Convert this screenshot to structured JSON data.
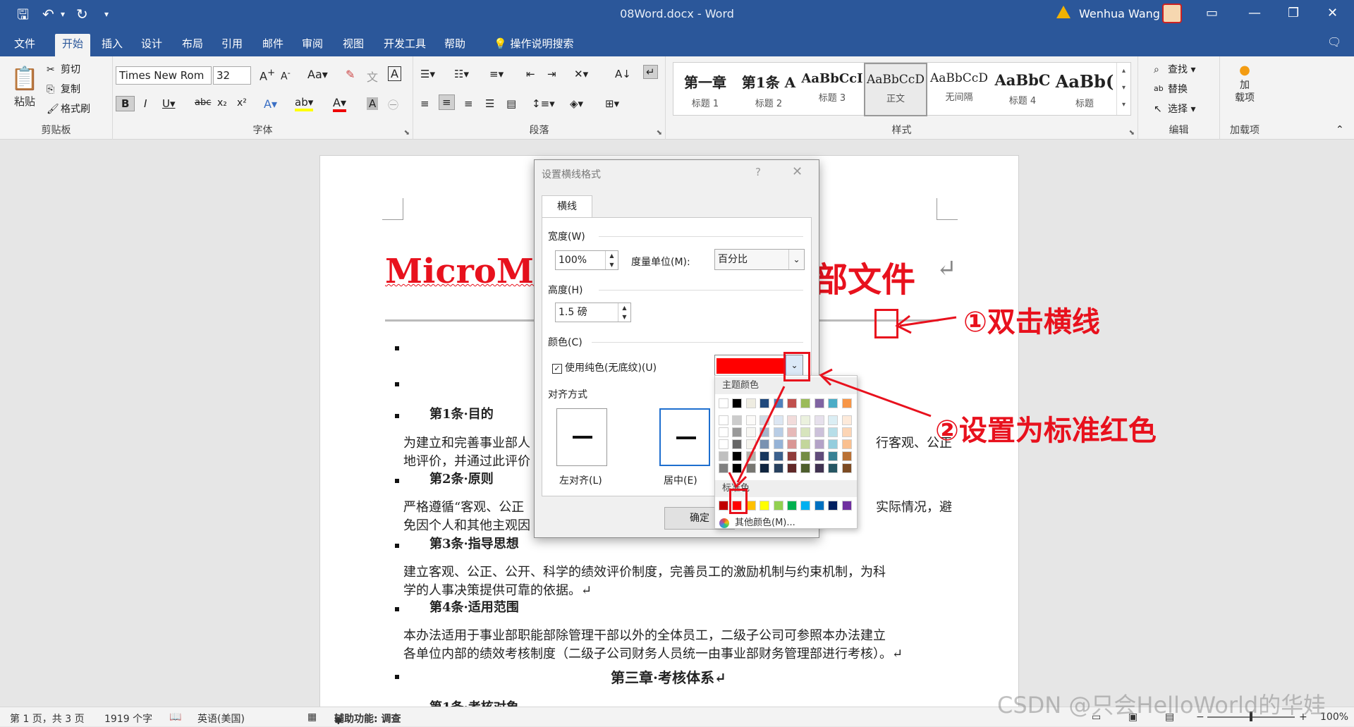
{
  "window": {
    "title": "08Word.docx  -  Word",
    "user": "Wenhua Wang"
  },
  "tabs": [
    "文件",
    "开始",
    "插入",
    "设计",
    "布局",
    "引用",
    "邮件",
    "审阅",
    "视图",
    "开发工具",
    "帮助"
  ],
  "tell_me": "操作说明搜索",
  "ribbon": {
    "clipboard": {
      "paste": "粘贴",
      "cut": "剪切",
      "copy": "复制",
      "format_painter": "格式刷",
      "label": "剪贴板"
    },
    "font": {
      "name": "Times New Rom",
      "size": "32",
      "label": "字体"
    },
    "paragraph": {
      "label": "段落"
    },
    "styles": {
      "label": "样式",
      "items": [
        {
          "sample": "第一章",
          "name": "标题 1"
        },
        {
          "sample": "第1条 A",
          "name": "标题 2"
        },
        {
          "sample": "AaBbCcI",
          "name": "标题 3"
        },
        {
          "sample": "AaBbCcD",
          "name": "正文"
        },
        {
          "sample": "AaBbCcD",
          "name": "无间隔"
        },
        {
          "sample": "AaBbC",
          "name": "标题 4"
        },
        {
          "sample": "AaBb(",
          "name": "标题"
        }
      ]
    },
    "editing": {
      "find": "查找",
      "replace": "替换",
      "select": "选择",
      "label": "编辑"
    },
    "addins": {
      "btn": "加\n载项",
      "label": "加载项"
    }
  },
  "document": {
    "heading_left": "MicroMa",
    "heading_right": "部文件",
    "lines": [
      {
        "text": "第1条·目的",
        "bold": true
      },
      {
        "text": "为建立和完善事业部人",
        "bold": false
      },
      {
        "text": "地评价，并通过此评价",
        "bold": false
      },
      {
        "text": "第2条·原则",
        "bold": true
      },
      {
        "text": "严格遵循“客观、公正",
        "bold": false
      },
      {
        "text": "免因个人和其他主观因",
        "bold": false
      },
      {
        "text": "第3条·指导思想",
        "bold": true
      },
      {
        "text": "建立客观、公正、公开、科学的绩效评价制度，完善员工的激励机制与约束机制，为科",
        "bold": false
      },
      {
        "text": "学的人事决策提供可靠的依据。↵",
        "bold": false
      },
      {
        "text": "第4条·适用范围",
        "bold": true
      },
      {
        "text": "本办法适用于事业部职能部除管理干部以外的全体员工，二级子公司可参照本办法建立",
        "bold": false
      },
      {
        "text": "各单位内部的绩效考核制度（二级子公司财务人员统一由事业部财务管理部进行考核）。↵",
        "bold": false
      },
      {
        "text": "第三章·考核体系↵",
        "bold": true
      },
      {
        "text": "第1条·考核对象",
        "bold": true
      }
    ],
    "right_frag1": "行客观、公正",
    "right_frag2": "实际情况，避"
  },
  "dialog": {
    "title": "设置横线格式",
    "tab": "横线",
    "width_label": "宽度(W)",
    "width_value": "100%",
    "unit_label": "度量单位(M):",
    "unit_value": "百分比",
    "height_label": "高度(H)",
    "height_value": "1.5 磅",
    "color_label": "颜色(C)",
    "solid_label": "使用纯色(无底纹)(U)",
    "align_label": "对齐方式",
    "align_left": "左对齐(L)",
    "align_center": "居中(E)",
    "ok": "确定",
    "selected_color": "#ff0000"
  },
  "palette": {
    "theme_label": "主题颜色",
    "standard_label": "标准色",
    "more": "其他颜色(M)...",
    "theme_top": [
      "#ffffff",
      "#000000",
      "#e7e6e6",
      "#44546a",
      "#4472c4",
      "#ed7d31",
      "#a5a5a5",
      "#ffc000",
      "#5b9bd5",
      "#70ad47"
    ],
    "theme_top_display": [
      "#ffffff",
      "#000000",
      "#eeece1",
      "#1f497d",
      "#4f81bd",
      "#c0504d",
      "#9bbb59",
      "#8064a2",
      "#4bacc6",
      "#f79646"
    ],
    "standard": [
      "#c00000",
      "#ff0000",
      "#ffc000",
      "#ffff00",
      "#92d050",
      "#00b050",
      "#00b0f0",
      "#0070c0",
      "#002060",
      "#7030a0"
    ]
  },
  "annotations": {
    "step1": "①双击横线",
    "step2": "②设置为标准红色"
  },
  "status": {
    "page": "第 1 页，共 3 页",
    "words": "1919 个字",
    "lang": "英语(美国)",
    "accessibility": "辅助功能: 调查",
    "zoom": "100%"
  },
  "watermark": "CSDN @只会HelloWorld的华娃"
}
